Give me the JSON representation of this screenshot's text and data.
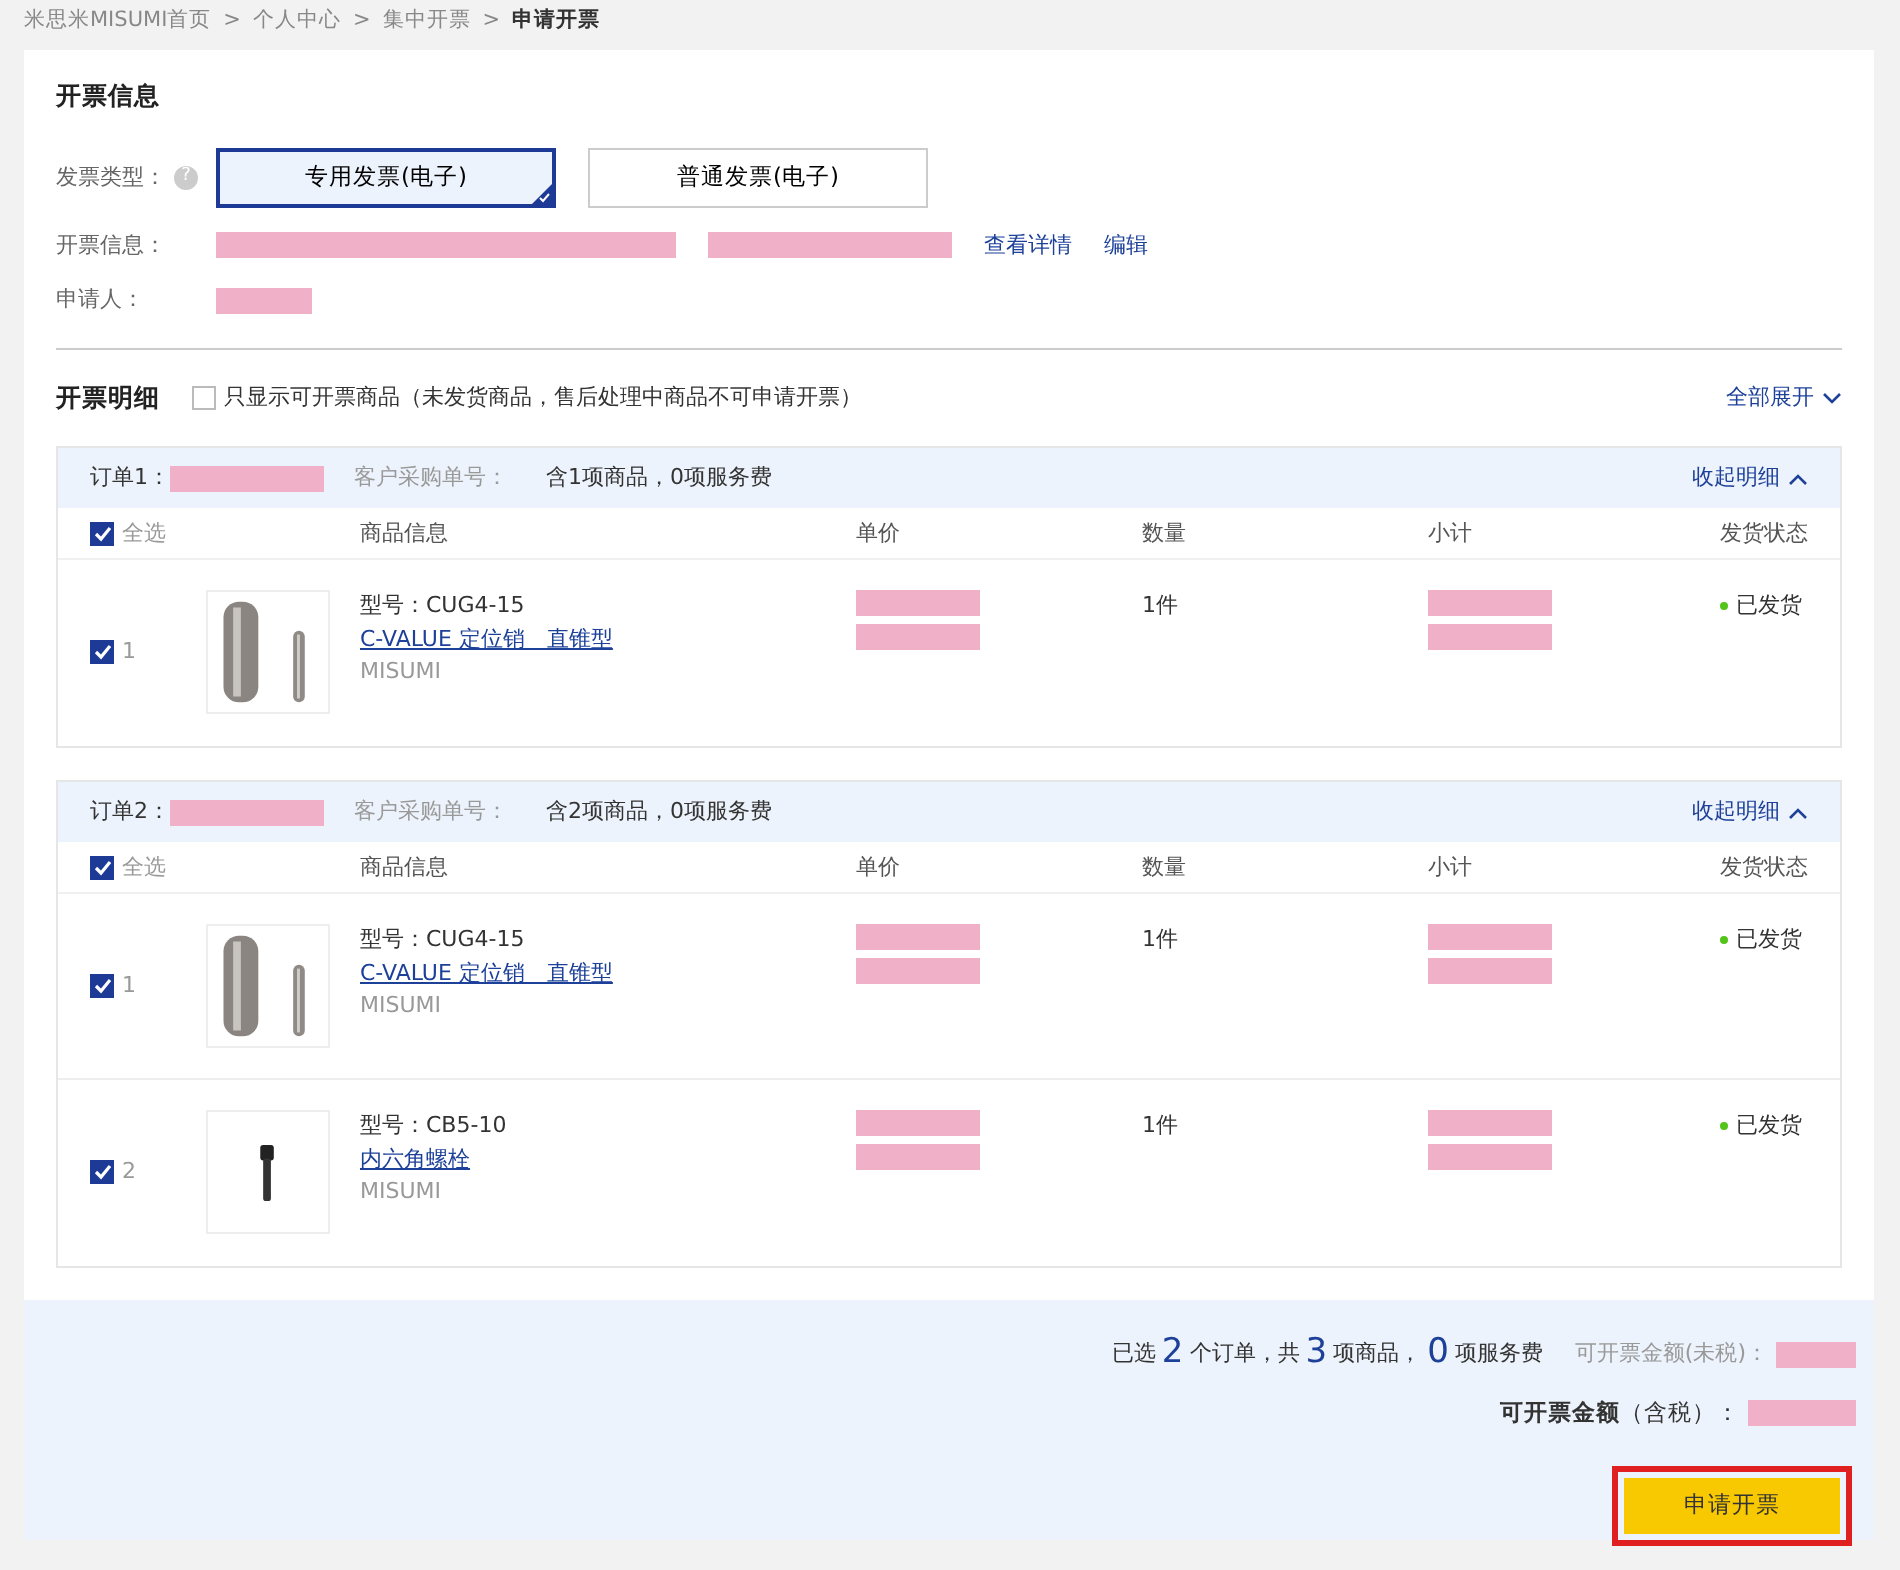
{
  "breadcrumb": [
    {
      "label": "米思米MISUMI首页",
      "current": false
    },
    {
      "label": "个人中心",
      "current": false
    },
    {
      "label": "集中开票",
      "current": false
    },
    {
      "label": "申请开票",
      "current": true
    }
  ],
  "breadcrumb_separator": ">",
  "invoice_info": {
    "title": "开票信息",
    "type_label": "发票类型：",
    "help_icon": "?",
    "types": [
      {
        "label": "专用发票(电子)",
        "selected": true
      },
      {
        "label": "普通发票(电子)",
        "selected": false
      }
    ],
    "info_label": "开票信息：",
    "info_links": [
      "查看详情",
      "编辑"
    ],
    "applicant_label": "申请人："
  },
  "details": {
    "title": "开票明细",
    "filter": {
      "label": "只显示可开票商品（未发货商品，售后处理中商品不可申请开票）",
      "checked": false
    },
    "toggle_all": {
      "label": "全部展开",
      "expanded": false
    }
  },
  "orders": [
    {
      "label": "订单1：",
      "po_label": "客户采购单号：",
      "summary": "含1项商品，0项服务费",
      "toggle": {
        "label": "收起明细",
        "expanded": true
      },
      "columns": [
        "商品信息",
        "单价",
        "数量",
        "小计",
        "发货状态"
      ],
      "select_all": {
        "label": "全选",
        "checked": true
      },
      "items": [
        {
          "index": "1",
          "checked": true,
          "model": "型号：CUG4-15",
          "name": "C-VALUE 定位销　直锥型",
          "brand": "MISUMI",
          "quantity": "1件",
          "status": "已发货",
          "color": "#52c41a"
        }
      ]
    },
    {
      "label": "订单2：",
      "po_label": "客户采购单号：",
      "summary": "含2项商品，0项服务费",
      "toggle": {
        "label": "收起明细",
        "expanded": true
      },
      "columns": [
        "商品信息",
        "单价",
        "数量",
        "小计",
        "发货状态"
      ],
      "select_all": {
        "label": "全选",
        "checked": true
      },
      "items": [
        {
          "index": "1",
          "checked": true,
          "model": "型号：CUG4-15",
          "name": "C-VALUE 定位销　直锥型",
          "brand": "MISUMI",
          "quantity": "1件",
          "status": "已发货",
          "color": "#52c41a"
        },
        {
          "index": "2",
          "checked": true,
          "model": "型号：CB5-10",
          "name": "内六角螺栓",
          "brand": "MISUMI",
          "quantity": "1件",
          "status": "已发货",
          "color": "#52c41a"
        }
      ]
    }
  ],
  "footer": {
    "summary": [
      {
        "kind": "label",
        "text": "已选"
      },
      {
        "kind": "number",
        "text": "2"
      },
      {
        "kind": "label",
        "text": "个订单，共"
      },
      {
        "kind": "number",
        "text": "3"
      },
      {
        "kind": "label",
        "text": "项商品，"
      },
      {
        "kind": "number",
        "text": "0"
      },
      {
        "kind": "label",
        "text": "项服务费"
      }
    ],
    "pretax_label": "可开票金额(未税)：",
    "total_label": "**可开票金额**（含税）：",
    "submit": "申请开票"
  }
}
